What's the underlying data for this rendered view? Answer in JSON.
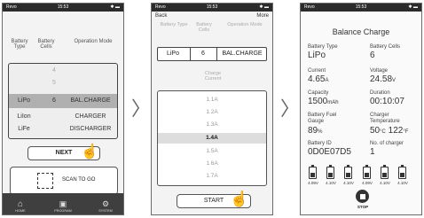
{
  "status": {
    "carrier": "Revo",
    "time": "15:53"
  },
  "screen1": {
    "headers": [
      "Battery Type",
      "Battery Cells",
      "Operation Mode"
    ],
    "cells_options_dim": [
      "4",
      "5"
    ],
    "selected_row": {
      "type": "LiPo",
      "cells": "6",
      "mode": "BAL.CHARGE"
    },
    "other_rows": [
      {
        "type": "LiIon",
        "mode": "CHARGER"
      },
      {
        "type": "LiFe",
        "mode": "DISCHARGER"
      }
    ],
    "next_label": "NEXT",
    "scan_label": "SCAN TO GO",
    "tabs": [
      "HOME",
      "PROGRAM",
      "SYSTEM"
    ]
  },
  "screen2": {
    "back_label": "Back",
    "more_label": "More",
    "headers": [
      "Battery Type",
      "Battery Cells",
      "Operation Mode"
    ],
    "values": [
      "LiPo",
      "6",
      "BAL.CHARGE"
    ],
    "current_label": "Charge Current",
    "currents": [
      "1.1A",
      "1.2A",
      "1.3A",
      "1.4A",
      "1.5A",
      "1.6A",
      "1.7A"
    ],
    "selected_index": 3,
    "start_label": "START"
  },
  "screen3": {
    "title": "Balance Charge",
    "battery_type_label": "Battery Type",
    "battery_type": "LiPo",
    "battery_cells_label": "Battery Cells",
    "battery_cells": "6",
    "current_label": "Current",
    "current_value": "4.65",
    "current_unit": "A",
    "voltage_label": "Voltage",
    "voltage_value": "24.58",
    "voltage_unit": "V",
    "capacity_label": "Capacity",
    "capacity_value": "1500",
    "capacity_unit": "mAh",
    "duration_label": "Duration",
    "duration_value": "00:10:07",
    "gauge_label": "Battery Fuel Gauge",
    "gauge_value": "89",
    "gauge_unit": "%",
    "temp_label": "Charger Temperature",
    "temp_c": "50",
    "temp_c_unit": "°C",
    "temp_f": "122",
    "temp_f_unit": "°F",
    "id_label": "Battery ID",
    "id_value": "0D0E07D5",
    "num_label": "No. of charger",
    "num_value": "1",
    "cell_voltages": [
      "4.09V",
      "4.10V",
      "4.10V",
      "4.09V",
      "4.10V",
      "4.10V"
    ],
    "stop_label": "STOP"
  }
}
